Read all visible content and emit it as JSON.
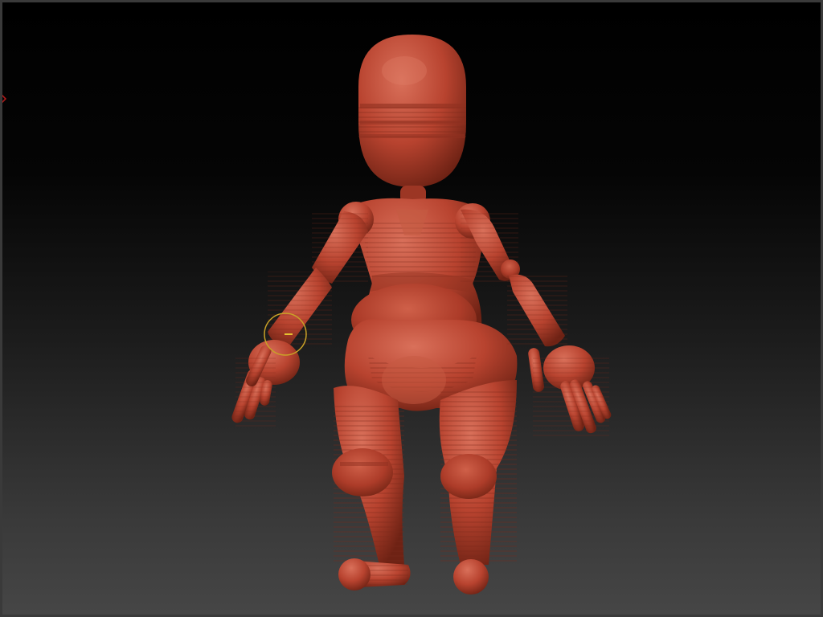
{
  "canvas": {
    "background_top": "#000000",
    "background_bottom": "#464646",
    "frame_color": "#3a3a3a"
  },
  "model": {
    "material_color": "#b8432f",
    "highlight_color": "#d9705a",
    "shadow_color": "#6e2214"
  },
  "brush_cursor": {
    "color": "#c9a227",
    "icon": "brush-circle-icon"
  },
  "edge_marker": {
    "color": "#b01a1a"
  }
}
